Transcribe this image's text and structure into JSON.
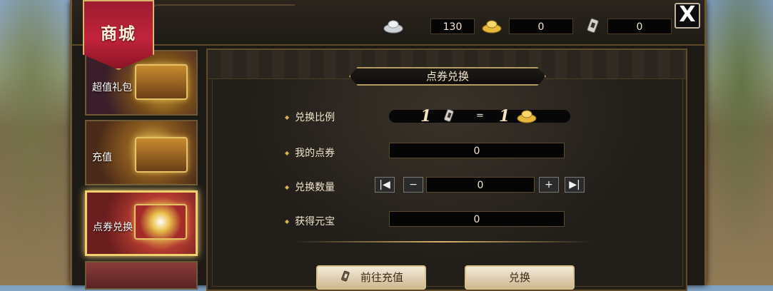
{
  "shop_tab": {
    "label": "商城"
  },
  "currencies": [
    {
      "icon": "silver-ingot-icon",
      "value": "130"
    },
    {
      "icon": "gold-ingot-icon",
      "value": "0"
    },
    {
      "icon": "coupon-icon",
      "value": "0"
    }
  ],
  "close_button": {
    "glyph": "X"
  },
  "sidebar": {
    "items": [
      {
        "label": "超值礼包"
      },
      {
        "label": "充值"
      },
      {
        "label": "点券兑换",
        "active": true
      },
      {
        "label": ""
      }
    ]
  },
  "panel": {
    "title": "点券兑换",
    "rows": {
      "ratio": {
        "label": "兑换比例",
        "left_value": "1",
        "equals": "=",
        "right_value": "1"
      },
      "my_coupons": {
        "label": "我的点券",
        "value": "0"
      },
      "amount": {
        "label": "兑换数量",
        "value": "0"
      },
      "gain": {
        "label": "获得元宝",
        "value": "0"
      }
    },
    "buttons": {
      "recharge": "前往充值",
      "exchange": "兑换"
    }
  },
  "colors": {
    "banner": "#c2243c",
    "gold_trim": "#d8c28c",
    "panel_bg": "#242019"
  }
}
